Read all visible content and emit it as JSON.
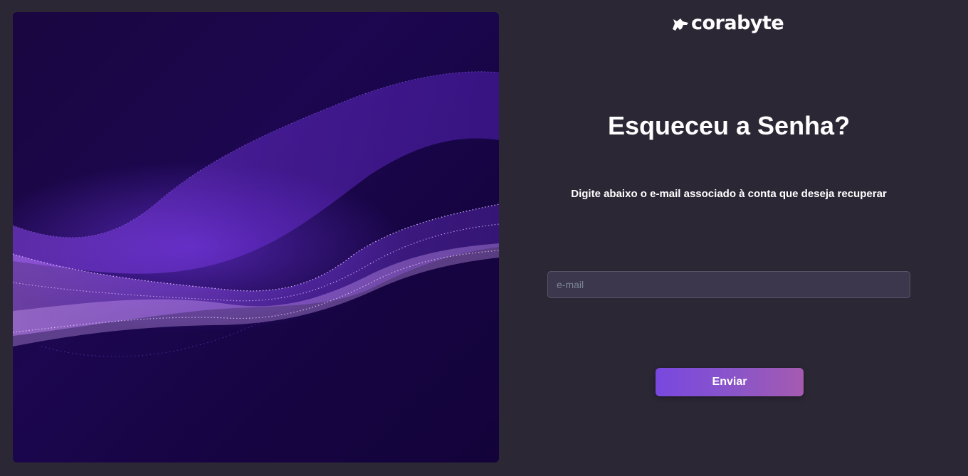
{
  "brand": {
    "name": "corabyte",
    "logo_icon": "wolf-icon"
  },
  "form": {
    "title": "Esqueceu a Senha?",
    "subtitle": "Digite abaixo o e-mail associado à conta que deseja recuperar",
    "email_placeholder": "e-mail",
    "email_value": "",
    "submit_label": "Enviar"
  },
  "colors": {
    "background": "#2c2735",
    "input_background": "#3d374e",
    "button_gradient_start": "#7848df",
    "button_gradient_end": "#a55ab0",
    "hero_wave": "#8a3df0"
  }
}
